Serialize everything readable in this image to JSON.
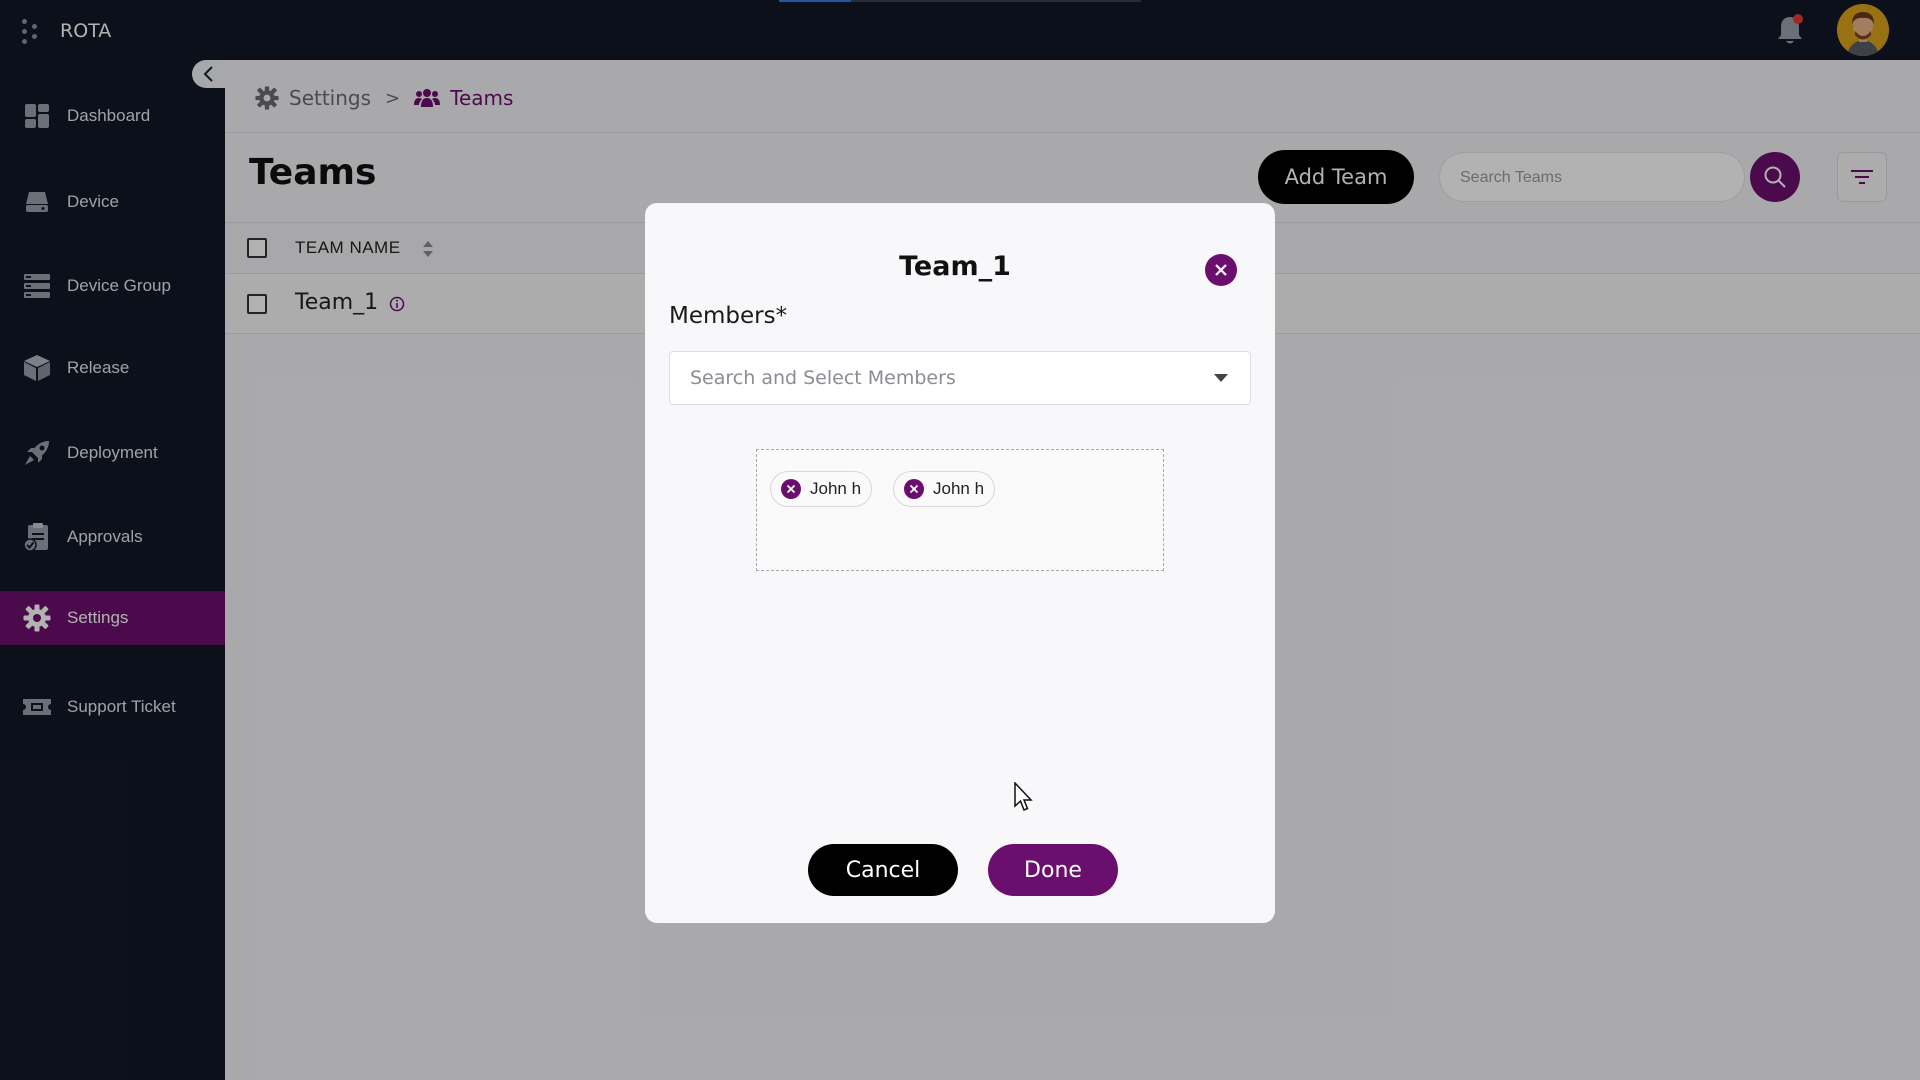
{
  "app": {
    "title": "ROTA",
    "progress": 0.2,
    "colors": {
      "accent": "#6b0f6e",
      "nav_bg": "#111827",
      "notification_dot": "#e53935"
    }
  },
  "sidebar": {
    "items": [
      {
        "label": "Dashboard",
        "icon": "dashboard-icon",
        "active": false
      },
      {
        "label": "Device",
        "icon": "device-icon",
        "active": false
      },
      {
        "label": "Device Group",
        "icon": "device-group-icon",
        "active": false
      },
      {
        "label": "Release",
        "icon": "release-box-icon",
        "active": false
      },
      {
        "label": "Deployment",
        "icon": "rocket-icon",
        "active": false
      },
      {
        "label": "Approvals",
        "icon": "approvals-icon",
        "active": false
      },
      {
        "label": "Settings",
        "icon": "gear-icon",
        "active": true
      },
      {
        "label": "Support Ticket",
        "icon": "ticket-icon",
        "active": false
      }
    ]
  },
  "breadcrumb": {
    "settings": "Settings",
    "separator": ">",
    "teams": "Teams"
  },
  "page": {
    "title": "Teams",
    "add_button": "Add Team",
    "search_placeholder": "Search Teams"
  },
  "table": {
    "columns": [
      "TEAM NAME"
    ],
    "rows": [
      {
        "name": "Team_1"
      }
    ]
  },
  "modal": {
    "title": "Team_1",
    "members_label": "Members*",
    "select_placeholder": "Search and Select Members",
    "chips": [
      "John h",
      "John h"
    ],
    "cancel_label": "Cancel",
    "done_label": "Done"
  }
}
